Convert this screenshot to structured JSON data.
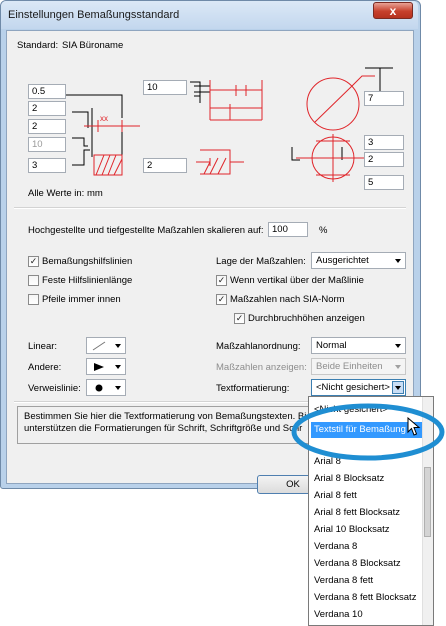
{
  "window": {
    "title": "Einstellungen Bemaßungsstandard",
    "close_glyph": "x"
  },
  "standard": {
    "label": "Standard:",
    "value": "SIA Büroname"
  },
  "diagram_fields": {
    "f1": "0.5",
    "f2": "2",
    "f3": "2",
    "f4": "10",
    "f5": "3",
    "f6": "10",
    "f7": "2",
    "f8": "7",
    "f9": "3",
    "f10": "2",
    "f11": "5",
    "xx_label": "xx"
  },
  "units_note": "Alle Werte in: mm",
  "scale": {
    "label": "Hochgestellte und tiefgestellte Maßzahlen skalieren auf:",
    "value": "100",
    "unit": "%"
  },
  "checkboxes": {
    "hilfslinien": {
      "label": "Bemaßungshilfslinien",
      "checked": "✓"
    },
    "feste": {
      "label": "Feste Hilfslinienlänge",
      "checked": ""
    },
    "pfeile": {
      "label": "Pfeile immer innen",
      "checked": ""
    },
    "vertikal": {
      "label": "Wenn vertikal über der Maßlinie",
      "checked": "✓"
    },
    "sia": {
      "label": "Maßzahlen nach SIA-Norm",
      "checked": "✓"
    },
    "durchbruch": {
      "label": "Durchbruchhöhen anzeigen",
      "checked": "✓"
    }
  },
  "lage": {
    "label": "Lage der Maßzahlen:",
    "value": "Ausgerichtet"
  },
  "linear": {
    "label": "Linear:"
  },
  "andere": {
    "label": "Andere:"
  },
  "verweis": {
    "label": "Verweislinie:"
  },
  "anordnung": {
    "label": "Maßzahlanordnung:",
    "value": "Normal"
  },
  "anzeigen": {
    "label": "Maßzahlen anzeigen:",
    "value": "Beide Einheiten"
  },
  "textformat": {
    "label": "Textformatierung:",
    "value": "<Nicht gesichert>"
  },
  "help_text": {
    "line1": "Bestimmen Sie hier die Textformatierung von Bemaßungstexten. Bi",
    "line2": "unterstützen die Formatierungen für Schrift, Schriftgröße und Schr"
  },
  "buttons": {
    "ok": "OK"
  },
  "dropdown_list": [
    "<Nicht gesichert>",
    "Textstil für Bemaßung",
    "Arial 8",
    "Arial 8 Blocksatz",
    "Arial 8 fett",
    "Arial 8 fett Blocksatz",
    "Arial 10 Blocksatz",
    "Verdana 8",
    "Verdana 8 Blocksatz",
    "Verdana 8 fett",
    "Verdana 8 fett Blocksatz",
    "Verdana 10"
  ],
  "colors": {
    "dim_red": "#e0252a",
    "highlight_ring": "#1f8ed2",
    "selection": "#3399ff"
  }
}
